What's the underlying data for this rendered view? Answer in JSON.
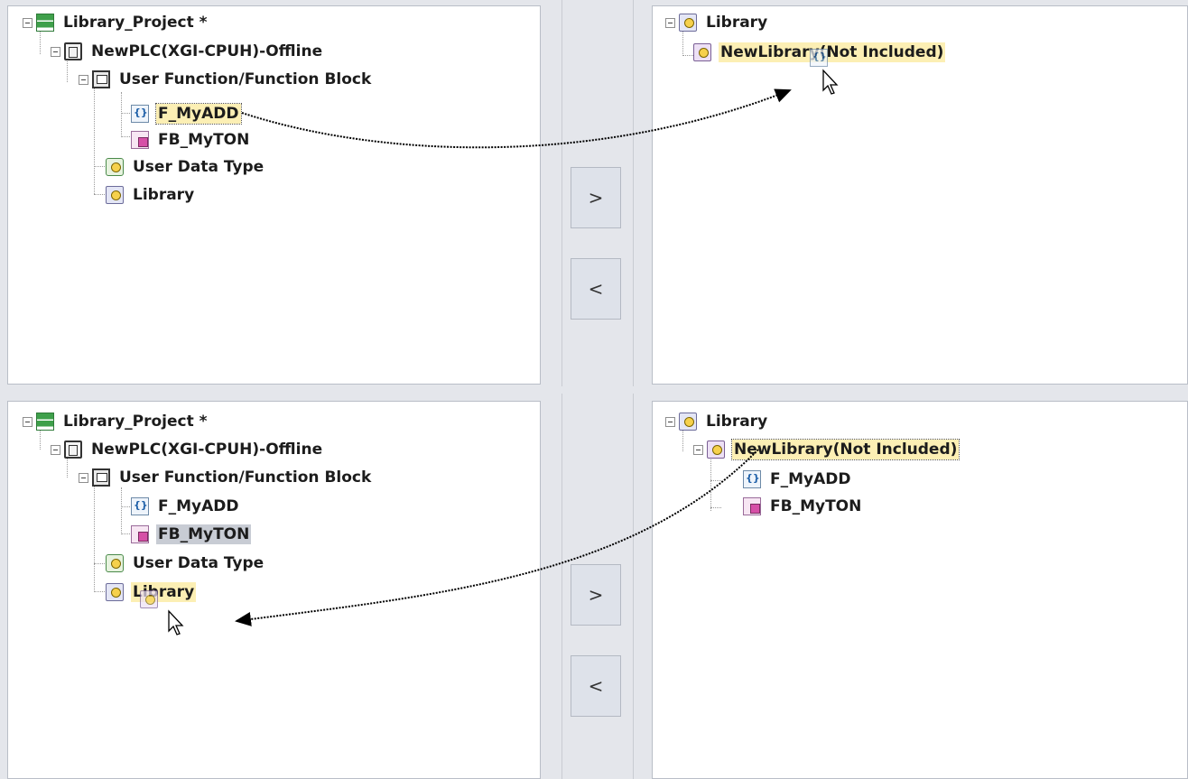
{
  "top": {
    "left_tree": {
      "project": "Library_Project *",
      "plc": "NewPLC(XGI-CPUH)-Offline",
      "folder": "User Function/Function Block",
      "func": "F_MyADD",
      "fb": "FB_MyTON",
      "udt": "User Data Type",
      "library": "Library"
    },
    "right_tree": {
      "library": "Library",
      "new_library": "NewLibrary(Not Included)"
    },
    "buttons": {
      "add": ">",
      "remove": "<"
    }
  },
  "bottom": {
    "left_tree": {
      "project": "Library_Project *",
      "plc": "NewPLC(XGI-CPUH)-Offline",
      "folder": "User Function/Function Block",
      "func": "F_MyADD",
      "fb": "FB_MyTON",
      "udt": "User Data Type",
      "library": "Library"
    },
    "right_tree": {
      "library": "Library",
      "new_library": "NewLibrary(Not Included)",
      "func": "F_MyADD",
      "fb": "FB_MyTON"
    },
    "buttons": {
      "add": ">",
      "remove": "<"
    }
  },
  "colors": {
    "highlight": "#fcefb4",
    "selected": "#c8ccd4",
    "panel_bg": "#ffffff",
    "frame_bg": "#e4e6eb"
  }
}
